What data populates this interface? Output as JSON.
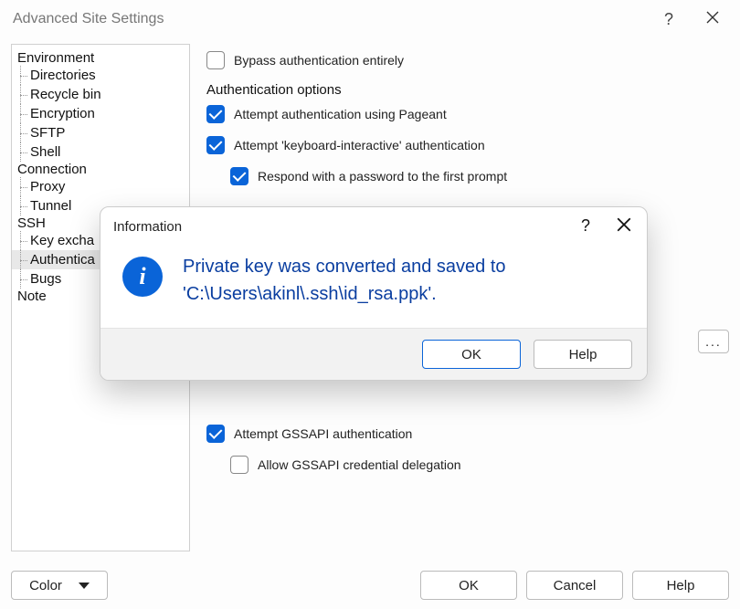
{
  "window": {
    "title": "Advanced Site Settings"
  },
  "tree": {
    "groups": [
      {
        "label": "Environment",
        "items": [
          "Directories",
          "Recycle bin",
          "Encryption",
          "SFTP",
          "Shell"
        ]
      },
      {
        "label": "Connection",
        "items": [
          "Proxy",
          "Tunnel"
        ]
      },
      {
        "label": "SSH",
        "items": [
          "Key exchange",
          "Authentication",
          "Bugs"
        ],
        "selectedIndex": 1
      },
      {
        "label": "Note",
        "items": []
      }
    ]
  },
  "content": {
    "bypass_label": "Bypass authentication entirely",
    "bypass_checked": false,
    "auth_options_legend": "Authentication options",
    "pageant_label": "Attempt authentication using Pageant",
    "pageant_checked": true,
    "ki_label": "Attempt 'keyboard-interactive' authentication",
    "ki_checked": true,
    "respond_label": "Respond with a password to the first prompt",
    "respond_checked": true,
    "browse_label": "...",
    "gssapi_attempt_label": "Attempt GSSAPI authentication",
    "gssapi_attempt_checked": true,
    "gssapi_delegate_label": "Allow GSSAPI credential delegation",
    "gssapi_delegate_checked": false
  },
  "footer": {
    "color_label": "Color",
    "ok_label": "OK",
    "cancel_label": "Cancel",
    "help_label": "Help"
  },
  "modal": {
    "title": "Information",
    "message": "Private key was converted and saved to 'C:\\Users\\akinl\\.ssh\\id_rsa.ppk'.",
    "ok_label": "OK",
    "help_label": "Help"
  }
}
